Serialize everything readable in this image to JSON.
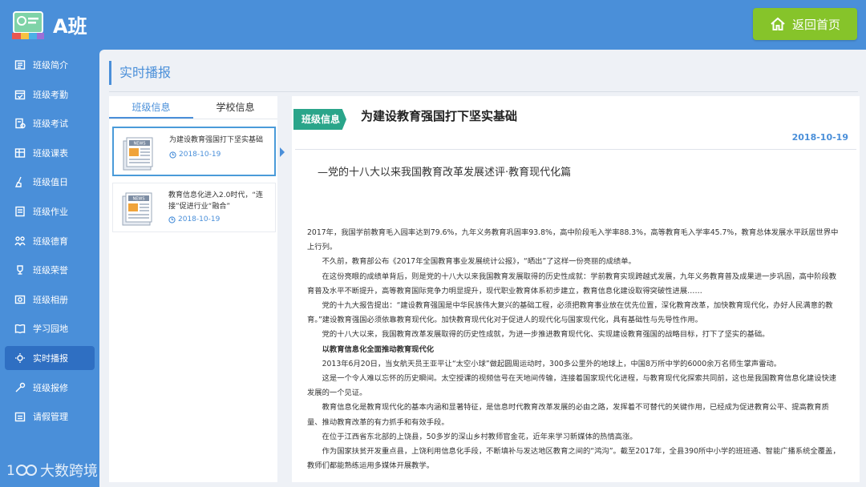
{
  "app": {
    "title": "A班"
  },
  "header": {
    "home_button": "返回首页"
  },
  "sidebar": {
    "items": [
      {
        "label": "班级简介",
        "icon": "info-icon"
      },
      {
        "label": "班级考勤",
        "icon": "calendar-check-icon"
      },
      {
        "label": "班级考试",
        "icon": "exam-icon"
      },
      {
        "label": "班级课表",
        "icon": "timetable-icon"
      },
      {
        "label": "班级值日",
        "icon": "cleaning-icon"
      },
      {
        "label": "班级作业",
        "icon": "homework-icon"
      },
      {
        "label": "班级德育",
        "icon": "moral-icon"
      },
      {
        "label": "班级荣誉",
        "icon": "trophy-icon"
      },
      {
        "label": "班级相册",
        "icon": "album-icon"
      },
      {
        "label": "学习园地",
        "icon": "book-icon"
      },
      {
        "label": "实时播报",
        "icon": "broadcast-icon",
        "active": true
      },
      {
        "label": "班级报修",
        "icon": "repair-icon"
      },
      {
        "label": "请假管理",
        "icon": "leave-icon"
      }
    ]
  },
  "watermark": {
    "text": "大数跨境"
  },
  "main": {
    "section_title": "实时播报",
    "tabs": [
      {
        "label": "班级信息",
        "active": true
      },
      {
        "label": "学校信息",
        "active": false
      }
    ],
    "news": [
      {
        "title": "为建设教育强国打下坚实基础",
        "date": "2018-10-19",
        "thumb_label": "NEWS",
        "selected": true
      },
      {
        "title": "教育信息化进入2.0时代，“连接”促进行业“融合”",
        "date": "2018-10-19",
        "thumb_label": "NEWS",
        "selected": false
      }
    ]
  },
  "article": {
    "tag": "班级信息",
    "title": "为建设教育强国打下坚实基础",
    "date": "2018-10-19",
    "subtitle": "—党的十八大以来我国教育改革发展述评·教育现代化篇",
    "paragraphs": [
      {
        "text": "2017年，我国学前教育毛入园率达到79.6%，九年义务教育巩固率93.8%，高中阶段毛入学率88.3%，高等教育毛入学率45.7%，教育总体发展水平跃居世界中上行列。",
        "style": "plain"
      },
      {
        "text": "不久前，教育部公布《2017年全国教育事业发展统计公报》，“晒出”了这样一份亮丽的成绩单。",
        "style": "ind"
      },
      {
        "text": "在这份亮眼的成绩单背后，则是党的十八大以来我国教育发展取得的历史性成就：学前教育实现跨越式发展，九年义务教育普及成果进一步巩固，高中阶段教育普及水平不断提升，高等教育国际竞争力明显提升，现代职业教育体系初步建立，教育信息化建设取得突破性进展……",
        "style": "ind"
      },
      {
        "text": "党的十九大报告提出：“建设教育强国是中华民族伟大复兴的基础工程，必须把教育事业放在优先位置，深化教育改革，加快教育现代化，办好人民满意的教育。”建设教育强国必须依靠教育现代化。加快教育现代化对于促进人的现代化与国家现代化，具有基础性与先导性作用。",
        "style": "ind"
      },
      {
        "text": "党的十八大以来，我国教育改革发展取得的历史性成就，为进一步推进教育现代化、实现建设教育强国的战略目标，打下了坚实的基础。",
        "style": "ind"
      },
      {
        "text": "以教育信息化全面推动教育现代化",
        "style": "bold"
      },
      {
        "text": "2013年6月20日，当女航天员王亚平让“太空小球”做起圆周运动时，300多公里外的地球上，中国8万所中学的6000余万名师生掌声雷动。",
        "style": "ind"
      },
      {
        "text": "这是一个令人难以忘怀的历史瞬间。太空授课的视频信号在天地间传输，连接着国家现代化进程，与教育现代化探索共同前，这也是我国教育信息化建设快速发展的一个见证。",
        "style": "ind"
      },
      {
        "text": "教育信息化是教育现代化的基本内涵和显著特征，是信息时代教育改革发展的必由之路，发挥着不可替代的关键作用，已经成为促进教育公平、提高教育质量、推动教育改革的有力抓手和有效手段。",
        "style": "ind"
      },
      {
        "text": "在位于江西省东北部的上饶县，50多岁的深山乡村教师官金花，近年来学习新媒体的热情高涨。",
        "style": "ind"
      },
      {
        "text": "作为国家扶贫开发重点县，上饶利用信息化手段，不断填补与发达地区教育之间的“鸿沟”。截至2017年，全县390所中小学的班班通、智能广播系统全覆盖，教师们都能熟练运用多媒体开展教学。",
        "style": "ind"
      }
    ]
  },
  "colors": {
    "primary": "#4a8fd9",
    "accent_green": "#86c42a",
    "tag_teal": "#2aa58a"
  }
}
